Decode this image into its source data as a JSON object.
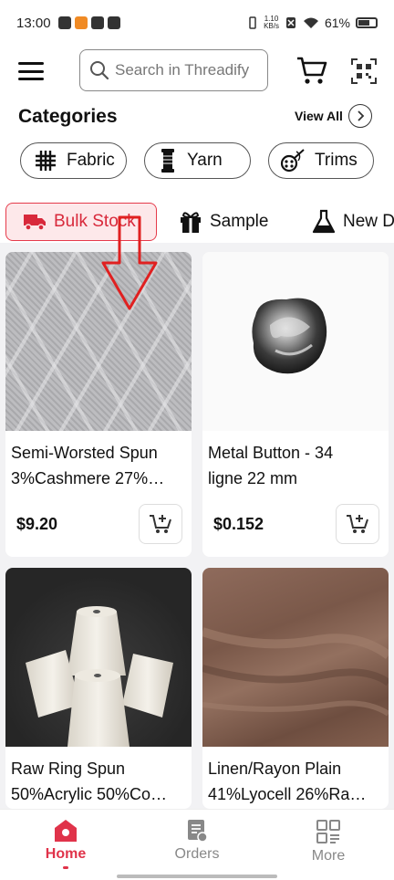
{
  "status": {
    "time": "13:00",
    "speed_top": "1.10",
    "speed_unit": "KB/s",
    "battery": "61%"
  },
  "header": {
    "search_placeholder": "Search in Threadify",
    "icons": [
      "menu-icon",
      "search-icon",
      "cart-icon",
      "qr-scan-icon"
    ]
  },
  "categories": {
    "title": "Categories",
    "view_all": "View All",
    "chips": [
      {
        "label": "Fabric",
        "icon": "fabric-icon"
      },
      {
        "label": "Yarn",
        "icon": "yarn-spool-icon"
      },
      {
        "label": "Trims",
        "icon": "thread-needle-icon"
      }
    ]
  },
  "tabs": [
    {
      "label": "Bulk Stock",
      "icon": "truck-icon",
      "active": true
    },
    {
      "label": "Sample",
      "icon": "gift-icon",
      "active": false
    },
    {
      "label": "New D",
      "icon": "flask-icon",
      "active": false
    }
  ],
  "products": [
    {
      "name1": "Semi-Worsted Spun",
      "name2": "3%Cashmere 27%…",
      "price": "$9.20"
    },
    {
      "name1": "Metal Button - 34",
      "name2": "ligne 22 mm",
      "price": "$0.152"
    },
    {
      "name1": "Raw Ring Spun",
      "name2": "50%Acrylic 50%Co…",
      "price": ""
    },
    {
      "name1": "Linen/Rayon Plain",
      "name2": "41%Lyocell 26%Ra…",
      "price": ""
    }
  ],
  "bottom_nav": [
    {
      "label": "Home",
      "icon": "home-icon",
      "active": true
    },
    {
      "label": "Orders",
      "icon": "orders-icon",
      "active": false
    },
    {
      "label": "More",
      "icon": "grid-icon",
      "active": false
    }
  ],
  "colors": {
    "accent": "#e0334a",
    "active_tab_bg": "#fde8ea",
    "annotation_arrow": "#e02020"
  }
}
